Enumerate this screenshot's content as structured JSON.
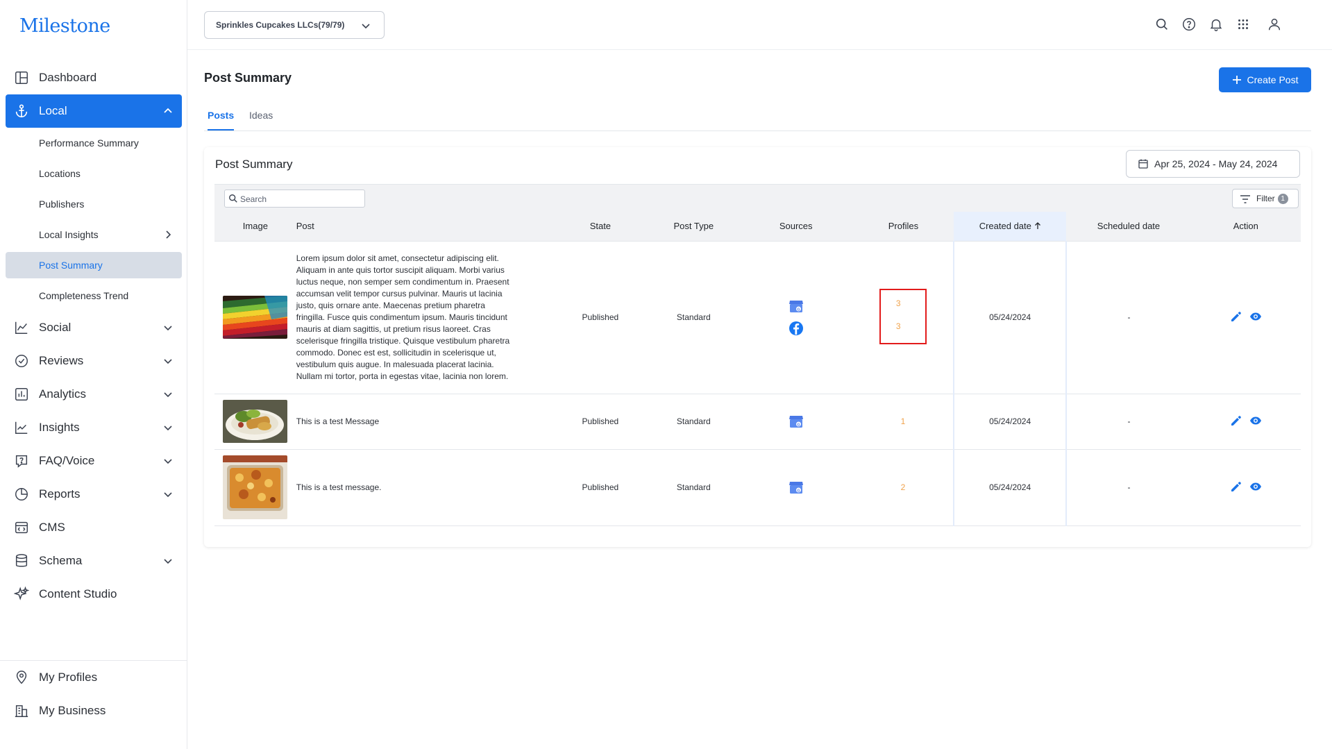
{
  "app": {
    "logo": "Milestone"
  },
  "sidebar": {
    "items": [
      {
        "label": "Dashboard",
        "icon": "dashboard-icon"
      },
      {
        "label": "Local",
        "icon": "anchor-icon",
        "active": true,
        "expanded": true
      },
      {
        "label": "Social",
        "icon": "line-chart-icon"
      },
      {
        "label": "Reviews",
        "icon": "check-circle-icon"
      },
      {
        "label": "Analytics",
        "icon": "bar-chart-icon"
      },
      {
        "label": "Insights",
        "icon": "trend-icon"
      },
      {
        "label": "FAQ/Voice",
        "icon": "faq-icon"
      },
      {
        "label": "Reports",
        "icon": "pie-chart-icon"
      },
      {
        "label": "CMS",
        "icon": "cms-icon"
      },
      {
        "label": "Schema",
        "icon": "database-icon"
      },
      {
        "label": "Content Studio",
        "icon": "sparkle-icon"
      }
    ],
    "local_sub": [
      {
        "label": "Performance Summary"
      },
      {
        "label": "Locations"
      },
      {
        "label": "Publishers"
      },
      {
        "label": "Local Insights"
      },
      {
        "label": "Post Summary",
        "selected": true
      },
      {
        "label": "Completeness Trend"
      }
    ],
    "bottom": [
      {
        "label": "My Profiles",
        "icon": "location-pin-icon"
      },
      {
        "label": "My Business",
        "icon": "building-icon"
      }
    ]
  },
  "topbar": {
    "account": "Sprinkles Cupcakes LLCs(79/79)"
  },
  "page": {
    "title": "Post Summary",
    "create_label": "Create Post",
    "tabs": [
      "Posts",
      "Ideas"
    ],
    "active_tab": "Posts"
  },
  "card": {
    "title": "Post Summary",
    "date_range": "Apr 25, 2024 - May 24, 2024",
    "search_placeholder": "Search",
    "filter_label": "Filter",
    "filter_count": "1"
  },
  "table": {
    "columns": [
      "Image",
      "Post",
      "State",
      "Post Type",
      "Sources",
      "Profiles",
      "Created date",
      "Scheduled date",
      "Action"
    ],
    "sorted_column": "Created date",
    "rows": [
      {
        "image": "colored-pencils",
        "post": "Lorem ipsum dolor sit amet, consectetur adipiscing elit. Aliquam in ante quis tortor suscipit aliquam. Morbi varius luctus neque, non semper sem condimentum in. Praesent accumsan velit tempor cursus pulvinar. Mauris ut lacinia justo, quis ornare ante. Maecenas pretium pharetra fringilla. Fusce quis condimentum ipsum. Mauris tincidunt mauris at diam sagittis, ut pretium risus laoreet. Cras scelerisque fringilla tristique. Quisque vestibulum pharetra commodo. Donec est est, sollicitudin in scelerisque ut, vestibulum quis augue. In malesuada placerat lacinia. Nullam mi tortor, porta in egestas vitae, lacinia non lorem.",
        "state": "Published",
        "post_type": "Standard",
        "sources": [
          "google-business-icon",
          "facebook-icon"
        ],
        "profiles": [
          "3",
          "3"
        ],
        "created": "05/24/2024",
        "scheduled": "-"
      },
      {
        "image": "salad-plate",
        "post": "This is a test Message",
        "state": "Published",
        "post_type": "Standard",
        "sources": [
          "google-business-icon"
        ],
        "profiles": [
          "1"
        ],
        "created": "05/24/2024",
        "scheduled": "-"
      },
      {
        "image": "baked-casserole",
        "post": "This is a test message.",
        "state": "Published",
        "post_type": "Standard",
        "sources": [
          "google-business-icon"
        ],
        "profiles": [
          "2"
        ],
        "created": "05/24/2024",
        "scheduled": "-"
      }
    ]
  },
  "colors": {
    "accent": "#1a73e8",
    "profile_count": "#f0a24a",
    "highlight_box": "#e21b1b"
  }
}
